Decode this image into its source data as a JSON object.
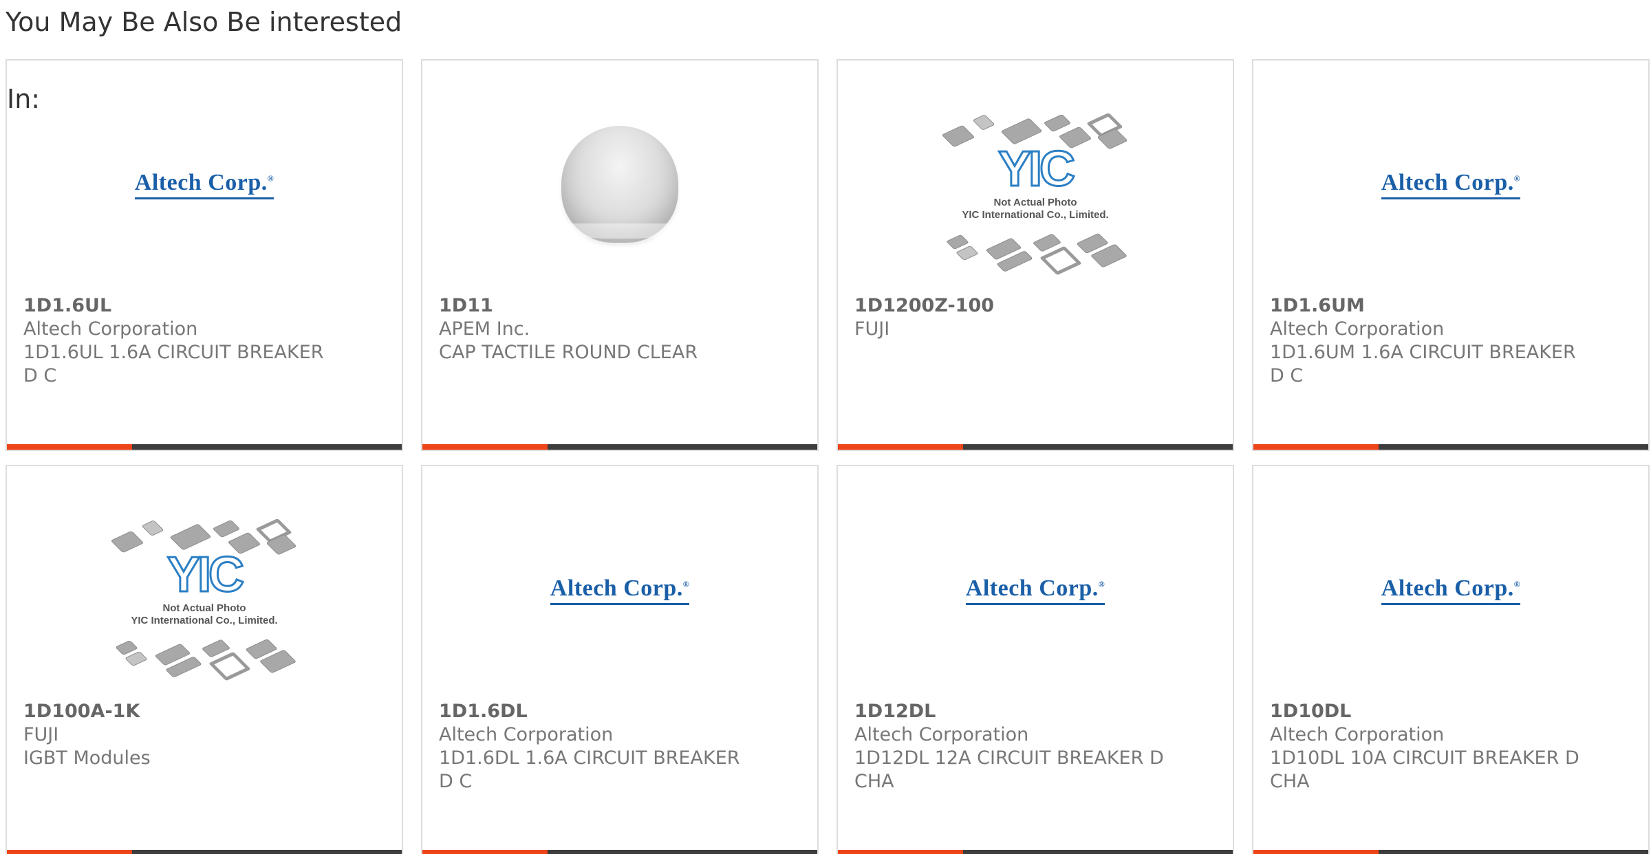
{
  "section": {
    "title": "You May Be Also Be interested",
    "in_label": "In:"
  },
  "colors": {
    "accent": "#ee4419",
    "bar_dark": "#3d3d3d",
    "border": "#dddddd",
    "logo_blue": "#1a5fa8"
  },
  "logos": {
    "altech": "Altech Corp.",
    "altech_mark": "®",
    "yic_letters": "YIC",
    "yic_line1": "Not Actual Photo",
    "yic_line2": "YIC International Co., Limited."
  },
  "products": [
    {
      "image": "altech-logo",
      "part_number": "1D1.6UL",
      "manufacturer": "Altech Corporation",
      "description_lines": [
        "1D1.6UL 1.6A CIRCUIT BREAKER",
        "D C"
      ]
    },
    {
      "image": "tactile-cap-photo",
      "part_number": "1D11",
      "manufacturer": "APEM Inc.",
      "description_lines": [
        "CAP TACTILE ROUND CLEAR"
      ]
    },
    {
      "image": "yic-placeholder",
      "part_number": "1D1200Z-100",
      "manufacturer": "FUJI",
      "description_lines": []
    },
    {
      "image": "altech-logo",
      "part_number": "1D1.6UM",
      "manufacturer": "Altech Corporation",
      "description_lines": [
        "1D1.6UM 1.6A CIRCUIT BREAKER",
        "D C"
      ]
    },
    {
      "image": "yic-placeholder",
      "part_number": "1D100A-1K",
      "manufacturer": "FUJI",
      "description_lines": [
        "IGBT Modules"
      ]
    },
    {
      "image": "altech-logo",
      "part_number": "1D1.6DL",
      "manufacturer": "Altech Corporation",
      "description_lines": [
        "1D1.6DL 1.6A CIRCUIT BREAKER",
        "D C"
      ]
    },
    {
      "image": "altech-logo",
      "part_number": "1D12DL",
      "manufacturer": "Altech Corporation",
      "description_lines": [
        "1D12DL 12A CIRCUIT BREAKER D",
        "CHA"
      ]
    },
    {
      "image": "altech-logo",
      "part_number": "1D10DL",
      "manufacturer": "Altech Corporation",
      "description_lines": [
        "1D10DL 10A CIRCUIT BREAKER D",
        "CHA"
      ]
    }
  ]
}
